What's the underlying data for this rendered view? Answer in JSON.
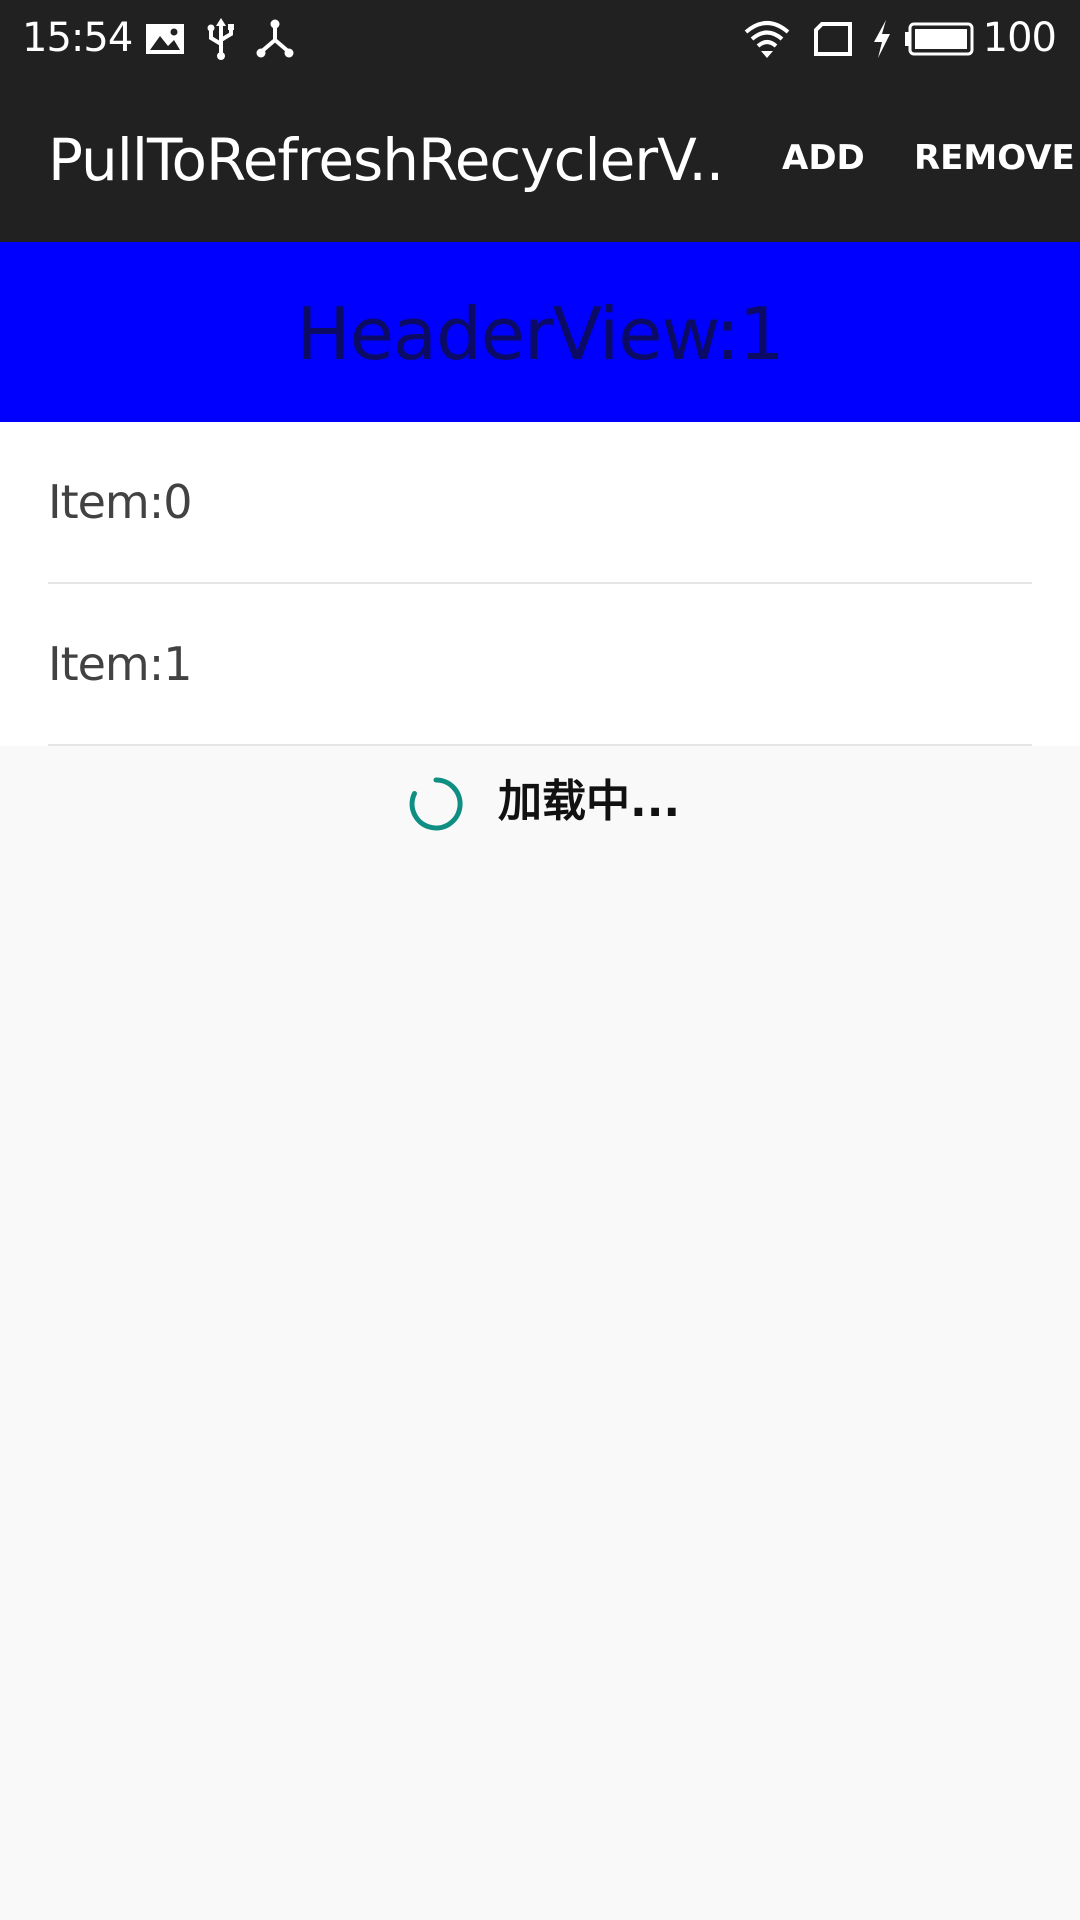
{
  "status_bar": {
    "time": "15:54",
    "battery_level": "100",
    "left_icons": [
      "image-icon",
      "usb-icon",
      "debug-share-icon"
    ],
    "right_icons": [
      "wifi-icon",
      "sim-card-icon",
      "charging-bolt-icon",
      "battery-icon"
    ]
  },
  "app_bar": {
    "title": "PullToRefreshRecyclerV..",
    "actions": {
      "add": "ADD",
      "remove": "REMOVE"
    },
    "background_color": "#212121"
  },
  "header_view": {
    "label": "HeaderView:1",
    "background_color": "#0000ff"
  },
  "list": {
    "items": [
      {
        "label": "Item:0"
      },
      {
        "label": "Item:1"
      }
    ]
  },
  "loading_footer": {
    "text": "加载中...",
    "spinner_color": "#0f8f82"
  }
}
